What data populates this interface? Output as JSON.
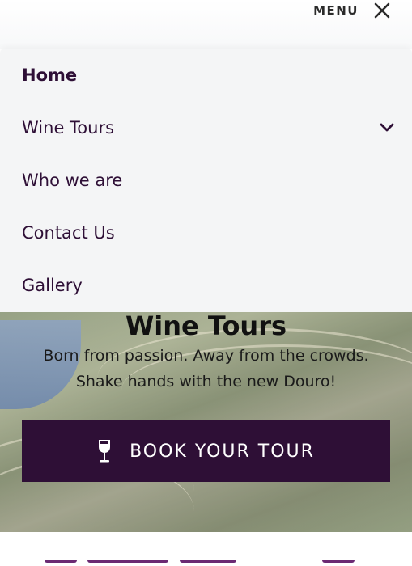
{
  "header": {
    "menu_label": "MENU"
  },
  "nav": {
    "items": [
      {
        "label": "Home",
        "active": true
      },
      {
        "label": "Wine Tours",
        "has_submenu": true
      },
      {
        "label": "Who we are"
      },
      {
        "label": "Contact Us"
      },
      {
        "label": "Gallery"
      }
    ]
  },
  "hero": {
    "title": "Wine Tours",
    "subtitle_line1": "Born from passion. Away from the crowds.",
    "subtitle_line2": "Shake hands with the new Douro!",
    "button_label": "BOOK YOUR TOUR",
    "button_icon": "wine-glass-icon"
  },
  "colors": {
    "brand": "#2e0f36",
    "nav_bg": "#f4f5f6",
    "accent": "#6b2a73"
  }
}
